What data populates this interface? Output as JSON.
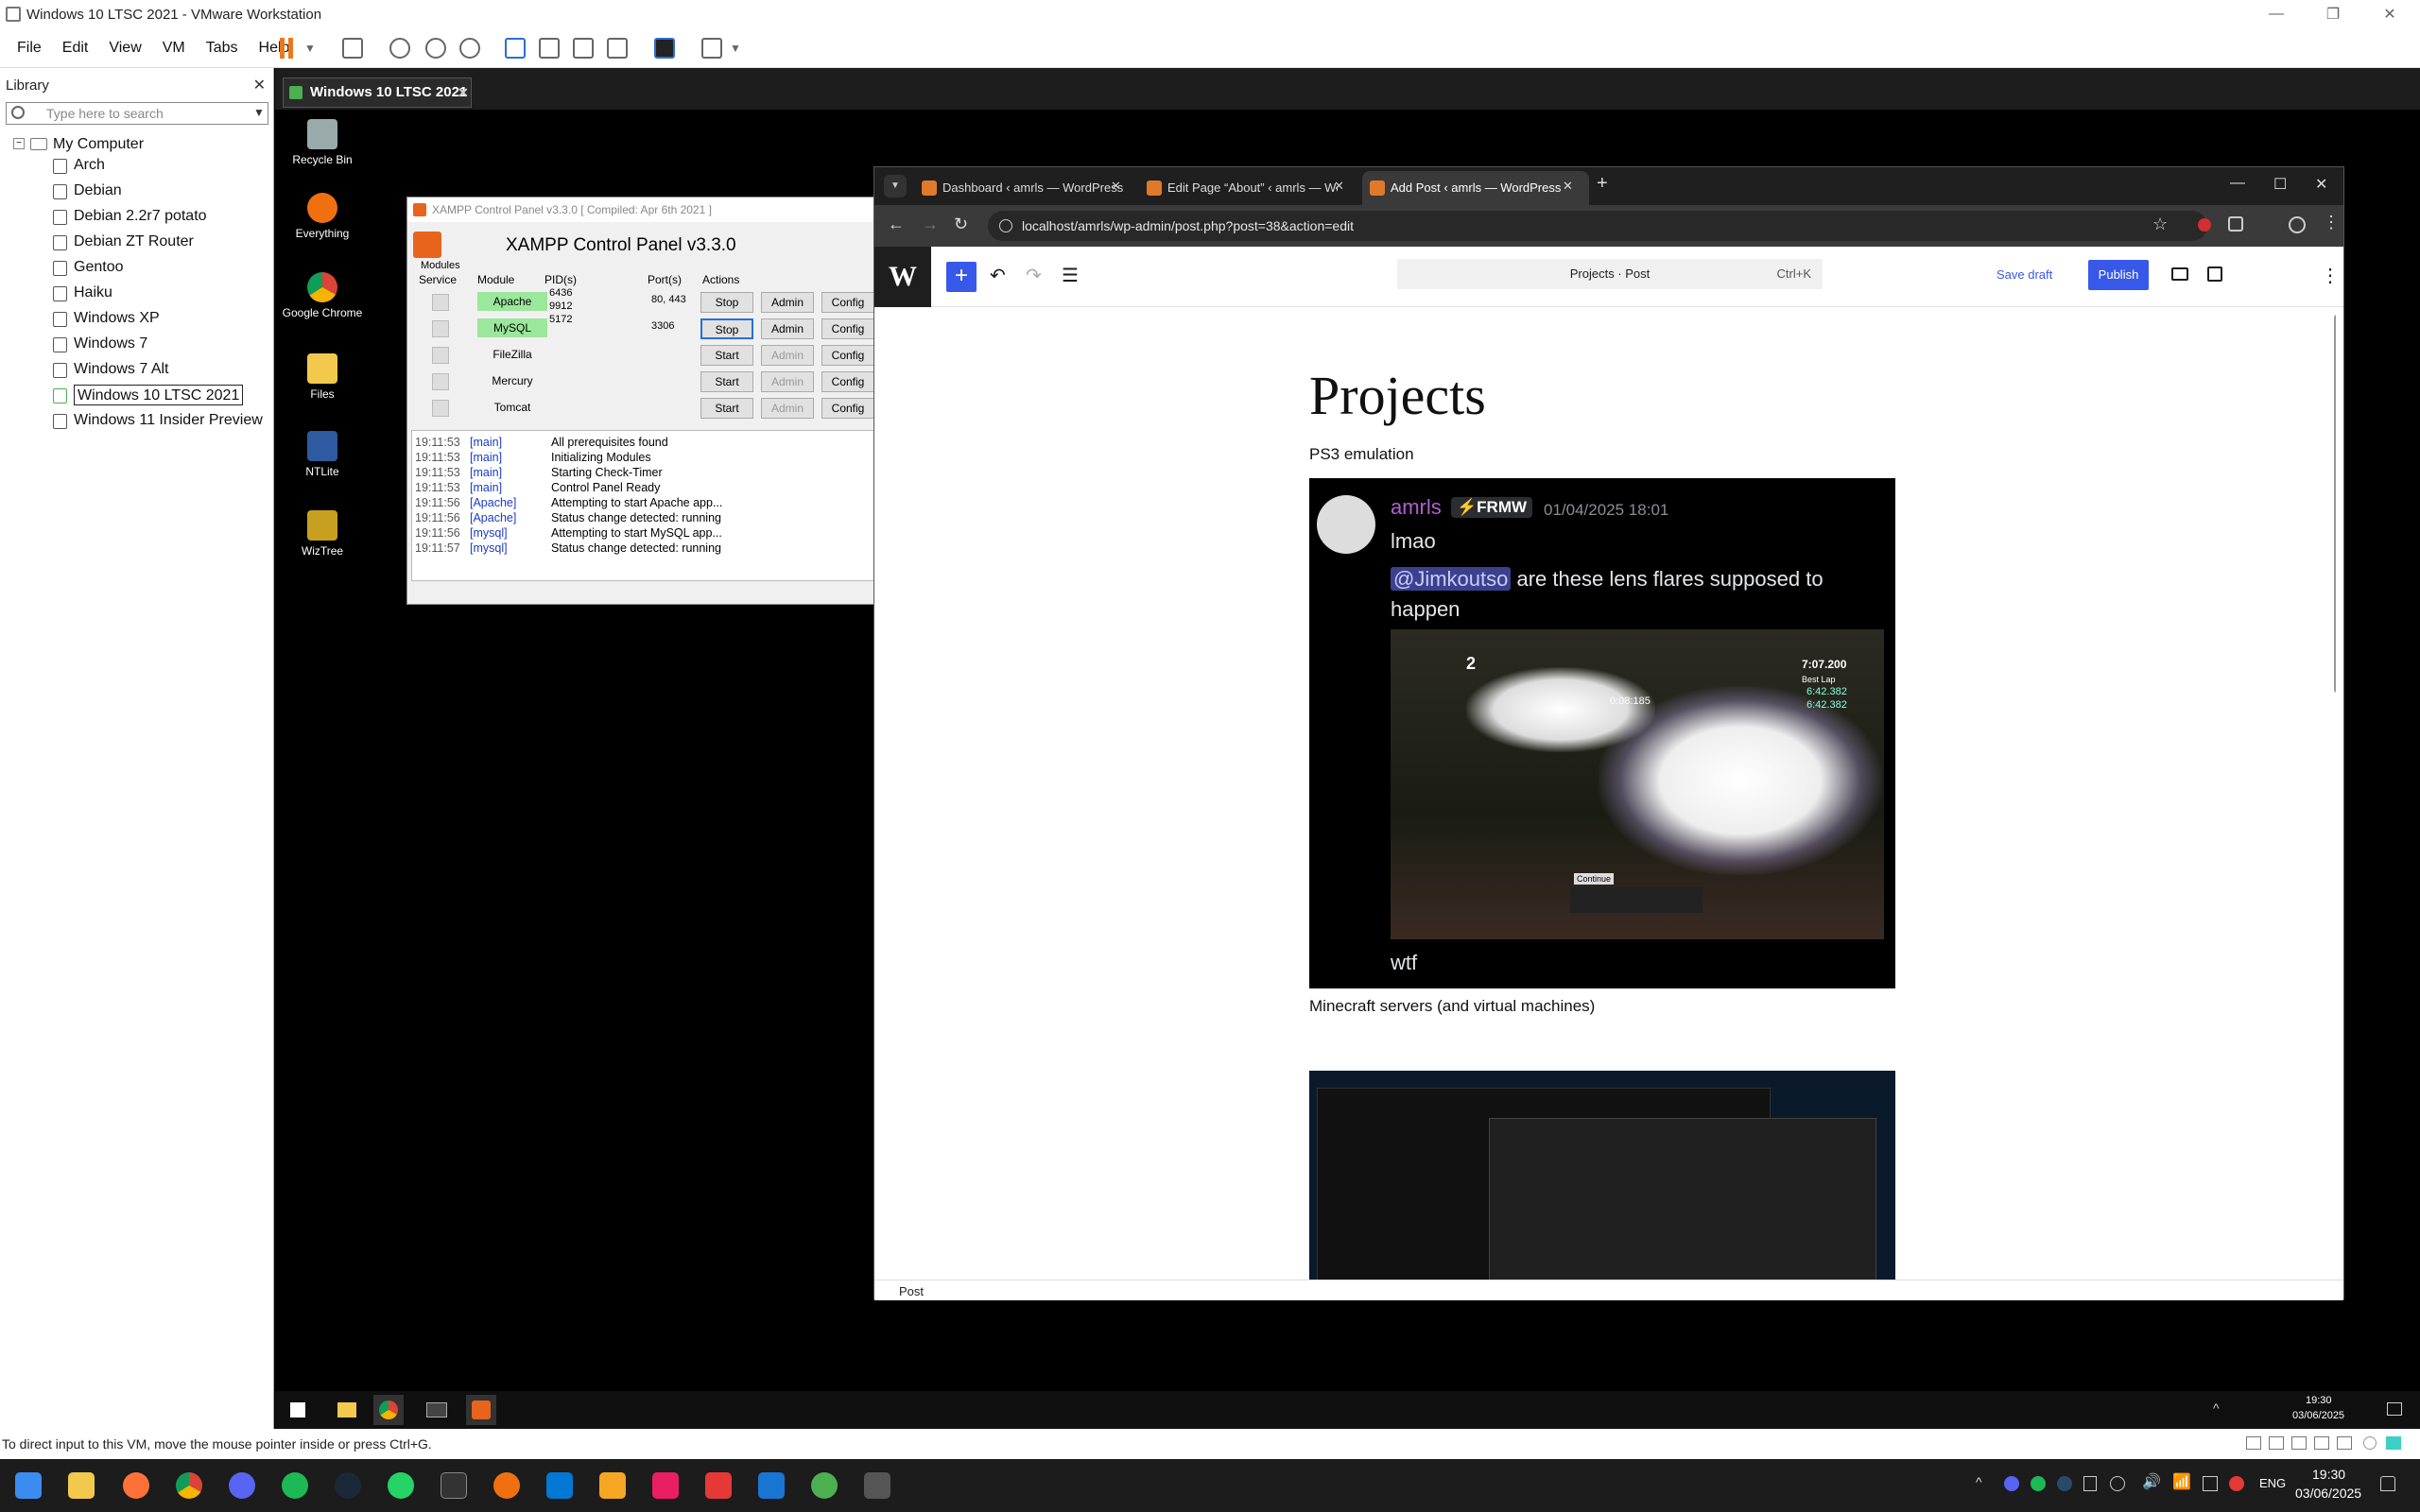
{
  "vmware": {
    "window_title": "Windows 10 LTSC 2021 - VMware Workstation",
    "menu": [
      "File",
      "Edit",
      "View",
      "VM",
      "Tabs",
      "Help"
    ],
    "library_title": "Library",
    "library_search_placeholder": "Type here to search",
    "library_root": "My Computer",
    "library_items": [
      "Arch",
      "Debian",
      "Debian 2.2r7 potato",
      "Debian ZT Router",
      "Gentoo",
      "Haiku",
      "Windows XP",
      "Windows 7",
      "Windows 7 Alt",
      "Windows 10 LTSC 2021",
      "Windows 11 Insider Preview"
    ],
    "selected_item": "Windows 10 LTSC 2021",
    "vm_tab": "Windows 10 LTSC 2021",
    "status_text": "To direct input to this VM, move the mouse pointer inside or press Ctrl+G."
  },
  "desktop_icons": [
    "Recycle Bin",
    "Everything",
    "Google Chrome",
    "Files",
    "NTLite",
    "WizTree"
  ],
  "xampp": {
    "window_title": "XAMPP Control Panel v3.3.0   [ Compiled: Apr 6th 2021 ]",
    "heading": "XAMPP Control Panel v3.3.0",
    "modules_label": "Modules",
    "headers": [
      "Service",
      "Module",
      "PID(s)",
      "Port(s)",
      "Actions"
    ],
    "rows": [
      {
        "module": "Apache",
        "pids": "6436\n9912",
        "ports": "80, 443",
        "action": "Stop",
        "running": true
      },
      {
        "module": "MySQL",
        "pids": "5172",
        "ports": "3306",
        "action": "Stop",
        "running": true
      },
      {
        "module": "FileZilla",
        "pids": "",
        "ports": "",
        "action": "Start",
        "running": false
      },
      {
        "module": "Mercury",
        "pids": "",
        "ports": "",
        "action": "Start",
        "running": false
      },
      {
        "module": "Tomcat",
        "pids": "",
        "ports": "",
        "action": "Start",
        "running": false
      }
    ],
    "admin_label": "Admin",
    "config_label": "Config",
    "log": [
      {
        "time": "19:11:53",
        "src": "[main]",
        "msg": "All prerequisites found"
      },
      {
        "time": "19:11:53",
        "src": "[main]",
        "msg": "Initializing Modules"
      },
      {
        "time": "19:11:53",
        "src": "[main]",
        "msg": "Starting Check-Timer"
      },
      {
        "time": "19:11:53",
        "src": "[main]",
        "msg": "Control Panel Ready"
      },
      {
        "time": "19:11:56",
        "src": "[Apache]",
        "msg": "Attempting to start Apache app..."
      },
      {
        "time": "19:11:56",
        "src": "[Apache]",
        "msg": "Status change detected: running"
      },
      {
        "time": "19:11:56",
        "src": "[mysql]",
        "msg": "Attempting to start MySQL app..."
      },
      {
        "time": "19:11:57",
        "src": "[mysql]",
        "msg": "Status change detected: running"
      }
    ]
  },
  "chrome": {
    "tabs": [
      "Dashboard ‹ amrls — WordPress",
      "Edit Page “About” ‹ amrls — WordPress",
      "Add Post ‹ amrls — WordPress"
    ],
    "url": "localhost/amrls/wp-admin/post.php?post=38&action=edit"
  },
  "wp": {
    "command_bar": "Projects · Post",
    "shortcut": "Ctrl+K",
    "save_draft": "Save draft",
    "publish": "Publish",
    "post_title": "Projects",
    "para1": "PS3 emulation",
    "discord": {
      "user": "amrls",
      "badge": "⚡FRMW",
      "date": "01/04/2025 18:01",
      "msg1": "lmao",
      "mention": "@Jimkoutso",
      "msg2a": " are these lens flares supposed to",
      "msg2b": "happen",
      "msg3": "wtf",
      "game_pos": "2",
      "game_time": "0:08:185",
      "game_total": "7:07.200",
      "best_lap": "Best Lap",
      "lap1": "6:42.382",
      "lap2": "6:42.382",
      "continue": "Continue"
    },
    "para2": "Minecraft servers (and virtual machines)",
    "footer": "Post"
  },
  "guest_clock": {
    "time": "19:30",
    "date": "03/06/2025"
  },
  "host_clock": {
    "time": "19:30",
    "date": "03/06/2025",
    "lang": "ENG"
  }
}
